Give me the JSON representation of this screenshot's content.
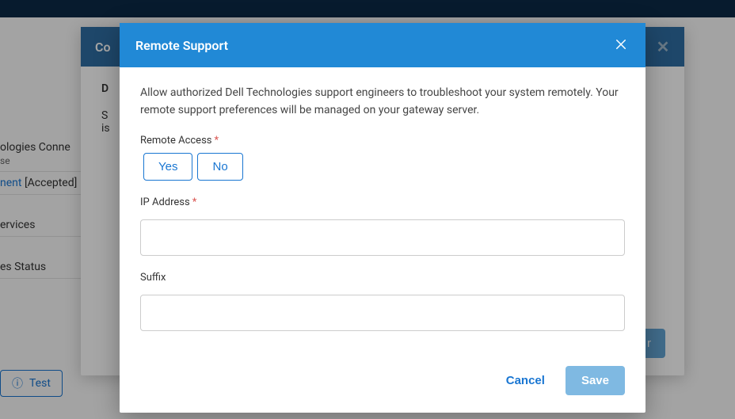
{
  "background": {
    "sidebar_title": "ologies Conne",
    "sidebar_sub": "se",
    "sidebar_link": "nent",
    "sidebar_link_suffix": " [Accepted]",
    "sidebar_row3": "ervices",
    "sidebar_row4": "es Status",
    "test_btn": "Test"
  },
  "outer_modal": {
    "title": "Co",
    "section_head": "D",
    "line1": "S",
    "line2": "is",
    "footer_btn": "r"
  },
  "modal": {
    "title": "Remote Support",
    "description": "Allow authorized Dell Technologies support engineers to troubleshoot your system remotely. Your remote support preferences will be managed on your gateway server.",
    "remote_access": {
      "label": "Remote Access",
      "yes": "Yes",
      "no": "No"
    },
    "ip": {
      "label": "IP Address",
      "value": ""
    },
    "suffix": {
      "label": "Suffix",
      "value": ""
    },
    "cancel": "Cancel",
    "save": "Save"
  }
}
